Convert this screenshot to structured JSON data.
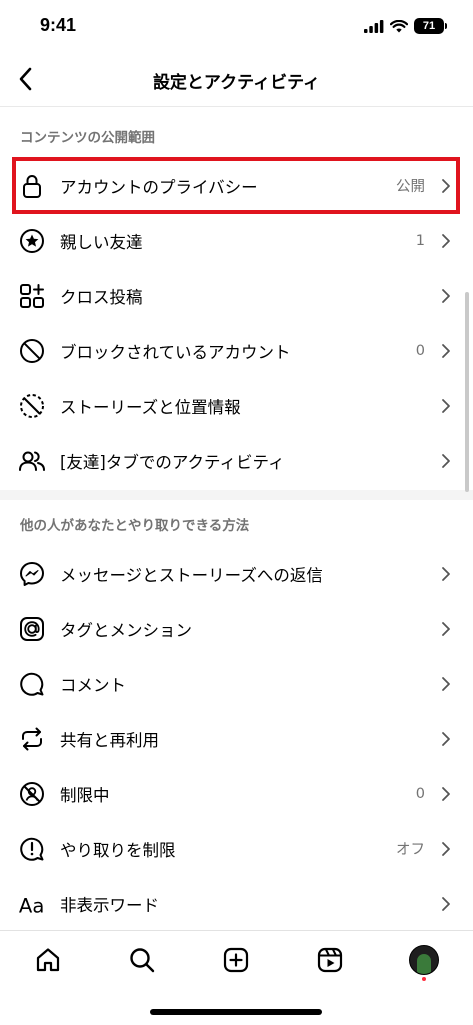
{
  "status": {
    "time": "9:41",
    "battery": "71"
  },
  "header": {
    "title": "設定とアクティビティ"
  },
  "sections": [
    {
      "title": "コンテンツの公開範囲",
      "items": [
        {
          "icon": "lock-icon",
          "label": "アカウントのプライバシー",
          "value": "公開"
        },
        {
          "icon": "star-circle-icon",
          "label": "親しい友達",
          "value": "1"
        },
        {
          "icon": "grid-plus-icon",
          "label": "クロス投稿",
          "value": ""
        },
        {
          "icon": "block-icon",
          "label": "ブロックされているアカウント",
          "value": "0"
        },
        {
          "icon": "story-hide-icon",
          "label": "ストーリーズと位置情報",
          "value": ""
        },
        {
          "icon": "people-icon",
          "label": "[友達]タブでのアクティビティ",
          "value": ""
        }
      ]
    },
    {
      "title": "他の人があなたとやり取りできる方法",
      "items": [
        {
          "icon": "messenger-icon",
          "label": "メッセージとストーリーズへの返信",
          "value": ""
        },
        {
          "icon": "at-sign-icon",
          "label": "タグとメンション",
          "value": ""
        },
        {
          "icon": "comment-icon",
          "label": "コメント",
          "value": ""
        },
        {
          "icon": "share-remix-icon",
          "label": "共有と再利用",
          "value": ""
        },
        {
          "icon": "restrict-icon",
          "label": "制限中",
          "value": "0"
        },
        {
          "icon": "limit-interactions-icon",
          "label": "やり取りを制限",
          "value": "オフ"
        },
        {
          "icon": "hidden-words-icon",
          "label": "非表示ワード",
          "value": ""
        }
      ]
    }
  ],
  "tabs": [
    "home-icon",
    "search-icon",
    "create-icon",
    "reels-icon",
    "profile-avatar"
  ],
  "colors": {
    "highlight": "#e0141e",
    "secondary_text": "#737373"
  }
}
